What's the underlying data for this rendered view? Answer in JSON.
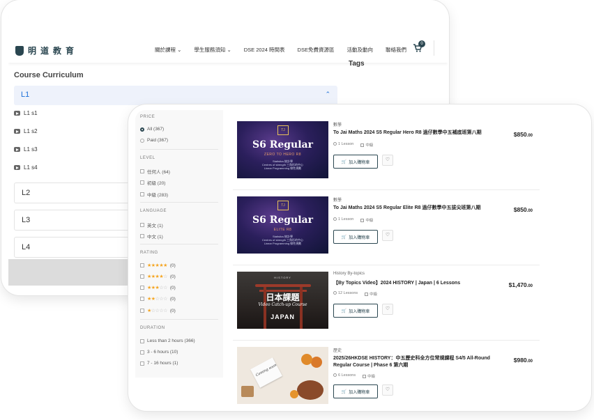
{
  "header": {
    "logo_text": "明道教育",
    "nav": [
      "關於課程 ⌄",
      "學生服務須知 ⌄",
      "DSE 2024 時間表",
      "DSE免費資源區",
      "活動及動向",
      "聯絡我們"
    ],
    "cart_count": "0"
  },
  "curriculum": {
    "tags_label": "Tags",
    "title": "Course Curriculum",
    "open_section": "L1",
    "lessons": [
      "L1 s1",
      "L1 s2",
      "L1 s3",
      "L1 s4"
    ],
    "sections": [
      "L2",
      "L3",
      "L4"
    ]
  },
  "filters": {
    "price": {
      "heading": "PRICE",
      "options": [
        "All (367)",
        "Paid (367)"
      ],
      "selected": "All (367)"
    },
    "level": {
      "heading": "LEVEL",
      "options": [
        "任何人 (64)",
        "初級 (20)",
        "中級 (283)"
      ]
    },
    "language": {
      "heading": "LANGUAGE",
      "options": [
        "英文 (1)",
        "中文 (1)"
      ]
    },
    "rating": {
      "heading": "RATING",
      "options": [
        {
          "stars": 5,
          "count": "(0)"
        },
        {
          "stars": 4,
          "count": "(0)"
        },
        {
          "stars": 3,
          "count": "(0)"
        },
        {
          "stars": 2,
          "count": "(0)"
        },
        {
          "stars": 1,
          "count": "(0)"
        }
      ]
    },
    "duration": {
      "heading": "DURATION",
      "options": [
        "Less than 2 hours (366)",
        "3 - 6 hours (10)",
        "7 - 16 hours (1)"
      ]
    }
  },
  "courses": [
    {
      "category": "數學",
      "title": "To Jai Maths 2024 S5 Regular Hero R8 過仔數學中五補底班第八期",
      "lessons": "1 Lesson",
      "level": "中級",
      "price": "$850",
      "price_cents": ".00",
      "thumb": {
        "logo": "TJ",
        "big": "S6 Regular",
        "sub": "ZERO TO HERO R8",
        "small": "Statistics 統計學\nCentres of strength 三角形的中心\nLinear Programming 線性規劃"
      },
      "add_label": "加入購物車"
    },
    {
      "category": "數學",
      "title": "To Jai Maths 2024 S5 Regular Elite R8 過仔數學中五拔尖班第八期",
      "lessons": "1 Lesson",
      "level": "中級",
      "price": "$850",
      "price_cents": ".00",
      "thumb": {
        "logo": "TJ",
        "big": "S6 Regular",
        "sub": "ELITE R8",
        "small": "Statistics 統計學\nCentres of strength 三角形的中心\nLinear Programming 線性規劃"
      },
      "add_label": "加入購物車"
    },
    {
      "category": "History By-topics",
      "title": "【By Topics Video】2024 HISTORY | Japan | 6 Lessons",
      "lessons": "12 Lessons",
      "level": "中級",
      "price": "$1,470",
      "price_cents": ".00",
      "thumb": {
        "hdr": "HISTORY",
        "cn": "日本課題",
        "script": "Video Catch-up Course",
        "jp": "JAPAN"
      },
      "add_label": "加入購物車"
    },
    {
      "category": "歷史",
      "title": "2025/26HKDSE HISTORY：中五歷史科全方位常規課程 S4/5 All-Round Regular Course | Phase 6 第六期",
      "lessons": "6 Lessons",
      "level": "中級",
      "price": "$980",
      "price_cents": ".00",
      "thumb": {
        "card": "Coming soon"
      },
      "add_label": "加入購物車"
    }
  ],
  "colors": {
    "brand": "#2a4650",
    "accent_blue": "#1b6fd8",
    "star": "#f5a623"
  }
}
